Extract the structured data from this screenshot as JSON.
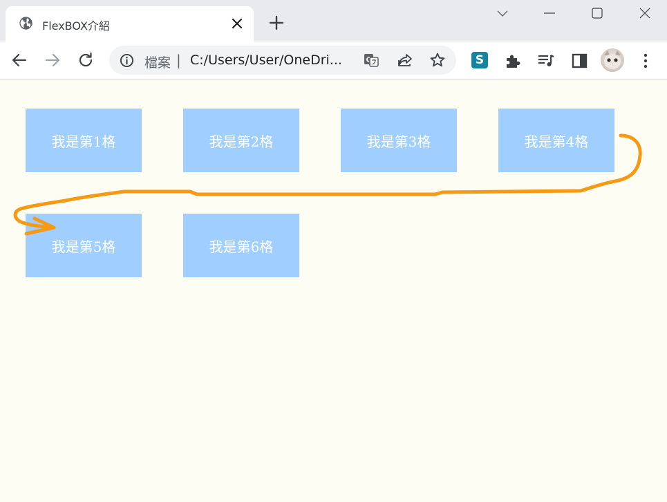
{
  "browser": {
    "tab": {
      "title": "FlexBOX介紹",
      "close_icon": "close-icon",
      "favicon": "globe-icon"
    },
    "window_controls": [
      "chevron-down-icon",
      "minimize-icon",
      "maximize-icon",
      "close-window-icon"
    ],
    "toolbar": {
      "back_icon": "back-arrow-icon",
      "forward_icon": "forward-arrow-icon",
      "reload_icon": "reload-icon",
      "omnibox": {
        "info_icon": "info-icon",
        "scheme_label": "檔案",
        "separator": "|",
        "url": "C:/Users/User/OneDri..."
      },
      "extension_s_label": "S"
    }
  },
  "page": {
    "items": [
      "我是第1格",
      "我是第2格",
      "我是第3格",
      "我是第4格",
      "我是第5格",
      "我是第6格"
    ]
  },
  "colors": {
    "item_background": "#a0cfff",
    "page_background": "#fdfdf3",
    "annotation_stroke": "#f59a14"
  }
}
